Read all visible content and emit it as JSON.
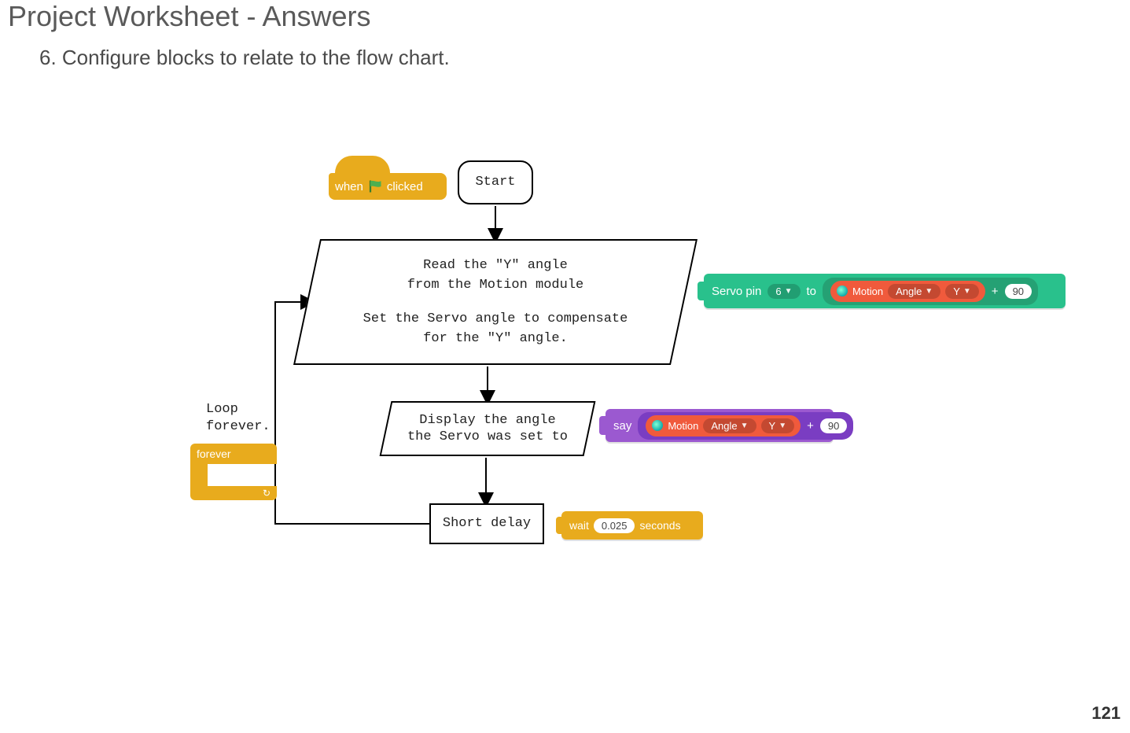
{
  "header": {
    "title": "Project Worksheet - Answers",
    "question": "6. Configure blocks to relate to the flow chart."
  },
  "pageNumber": "121",
  "flowchart": {
    "start": "Start",
    "process1": {
      "l1": "Read the \"Y\" angle",
      "l2": "from the Motion module",
      "l3": "Set the Servo angle to compensate",
      "l4": "for the \"Y\" angle."
    },
    "process2": {
      "l1": "Display the angle",
      "l2": "the Servo was set to"
    },
    "delay": "Short delay",
    "loop": {
      "l1": "Loop",
      "l2": "forever."
    }
  },
  "blocks": {
    "hat": {
      "when": "when",
      "clicked": "clicked"
    },
    "forever": "forever",
    "servo": {
      "label1": "Servo pin",
      "pin": "6",
      "to": "to",
      "motion": "Motion",
      "angle": "Angle",
      "axis": "Y",
      "plus": "+",
      "value": "90"
    },
    "say": {
      "label": "say",
      "motion": "Motion",
      "angle": "Angle",
      "axis": "Y",
      "plus": "+",
      "value": "90"
    },
    "wait": {
      "label1": "wait",
      "value": "0.025",
      "label2": "seconds"
    }
  }
}
